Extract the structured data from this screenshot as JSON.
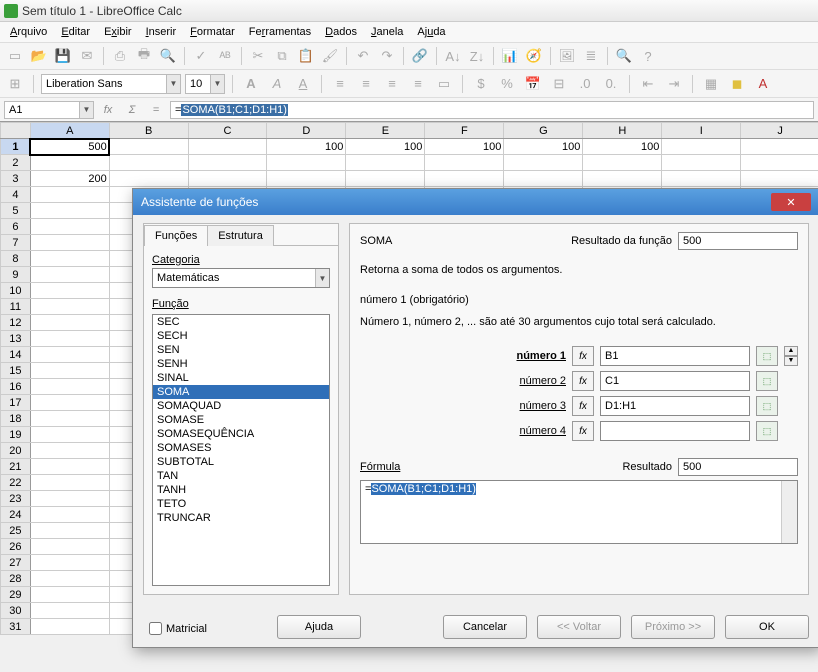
{
  "title": "Sem título 1 - LibreOffice Calc",
  "menu": [
    "Arquivo",
    "Editar",
    "Exibir",
    "Inserir",
    "Formatar",
    "Ferramentas",
    "Dados",
    "Janela",
    "Ajuda"
  ],
  "font": {
    "name": "Liberation Sans",
    "size": "10"
  },
  "cell_ref": "A1",
  "formula_prefix": "=",
  "formula_body": "SOMA(B1;C1;D1:H1)",
  "columns": [
    "A",
    "B",
    "C",
    "D",
    "E",
    "F",
    "G",
    "H",
    "I",
    "J"
  ],
  "rows": {
    "1": {
      "A": "500",
      "D": "100",
      "E": "100",
      "F": "100",
      "G": "100",
      "H": "100"
    },
    "3": {
      "A": "200"
    }
  },
  "row_count": 31,
  "dialog": {
    "title": "Assistente de funções",
    "tabs": [
      "Funções",
      "Estrutura"
    ],
    "cat_label": "Categoria",
    "category": "Matemáticas",
    "func_label": "Função",
    "functions": [
      "SEC",
      "SECH",
      "SEN",
      "SENH",
      "SINAL",
      "SOMA",
      "SOMAQUAD",
      "SOMASE",
      "SOMASEQUÊNCIA",
      "SOMASES",
      "SUBTOTAL",
      "TAN",
      "TANH",
      "TETO",
      "TRUNCAR"
    ],
    "selected_fn": "SOMA",
    "matricial": "Matricial",
    "fn_name": "SOMA",
    "result_label": "Resultado da função",
    "result_value": "500",
    "description": "Retorna a soma de todos os argumentos.",
    "arg_title": "número 1 (obrigatório)",
    "arg_desc": "Número 1, número 2, ... são até 30 argumentos cujo total será calculado.",
    "args": [
      {
        "label": "número 1",
        "value": "B1",
        "bold": true
      },
      {
        "label": "número 2",
        "value": "C1",
        "bold": false
      },
      {
        "label": "número 3",
        "value": "D1:H1",
        "bold": false
      },
      {
        "label": "número 4",
        "value": "",
        "bold": false
      }
    ],
    "formula_label": "Fórmula",
    "res2_label": "Resultado",
    "res2_value": "500",
    "formula_box_prefix": "=",
    "formula_box_sel": "SOMA(B1;C1;D1:H1)",
    "buttons": {
      "help": "Ajuda",
      "cancel": "Cancelar",
      "back": "<< Voltar",
      "next": "Próximo >>",
      "ok": "OK"
    }
  }
}
